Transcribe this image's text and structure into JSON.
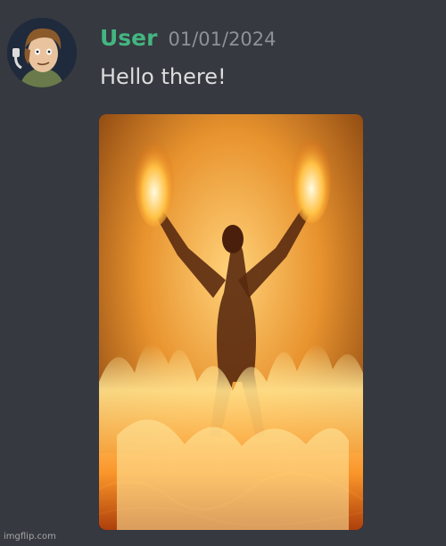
{
  "message": {
    "author": {
      "name": "User",
      "name_color": "#43b581"
    },
    "timestamp": "01/01/2024",
    "text": "Hello there!",
    "attachment": {
      "kind": "image",
      "subject": "burning-figure"
    }
  },
  "watermark": "imgflip.com",
  "colors": {
    "background": "#36393f",
    "text": "#dcddde",
    "timestamp": "#8e9297"
  }
}
